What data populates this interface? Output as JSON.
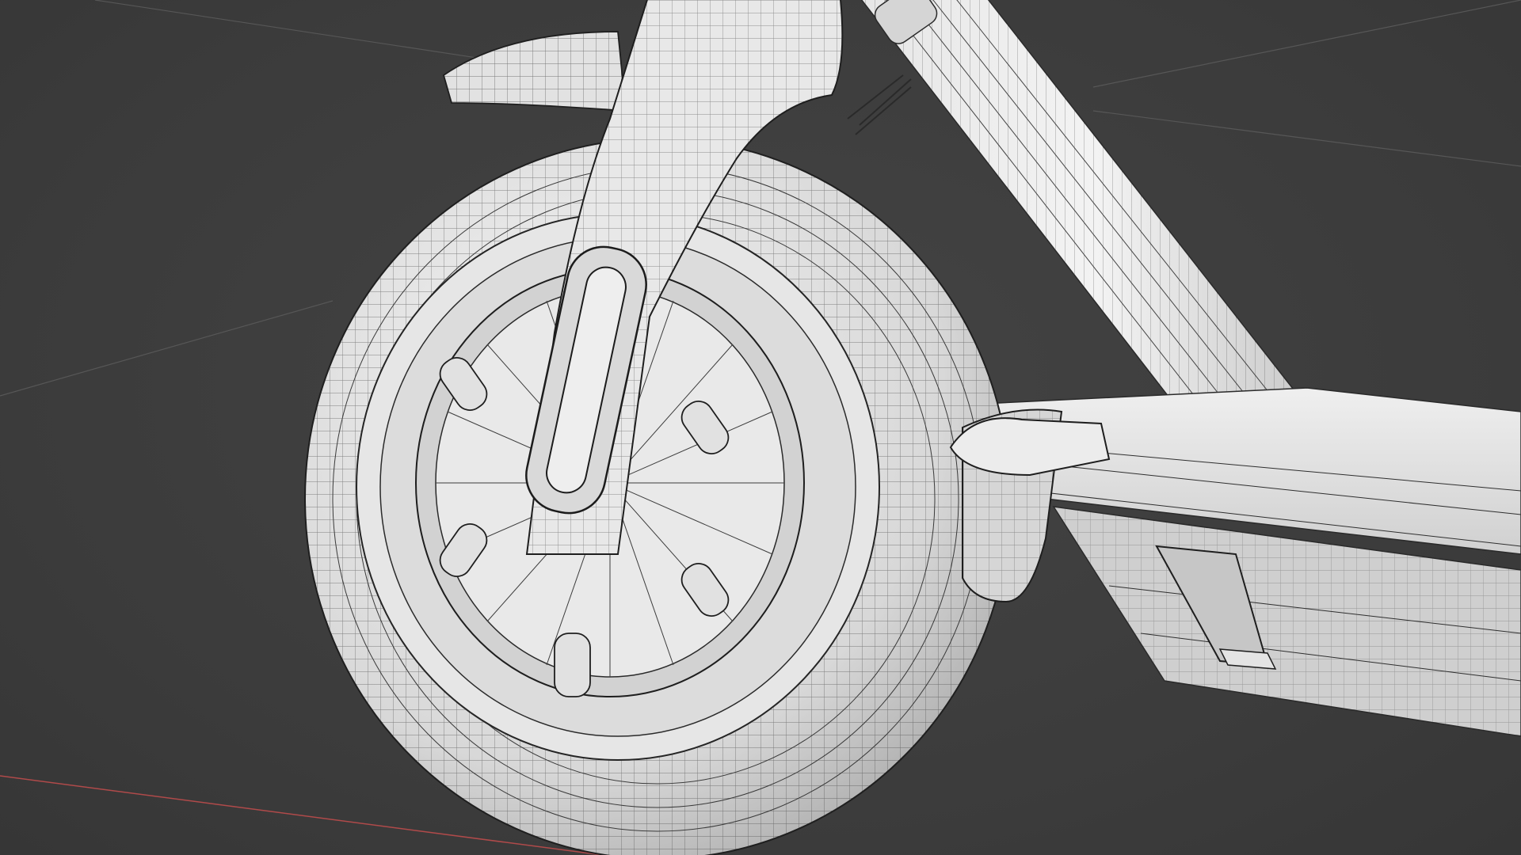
{
  "viewport": {
    "background_color": "#3d3d3d",
    "grid_line_color": "#575757",
    "x_axis_color": "#b04a4a",
    "mesh_fill_color": "#dcdcdc",
    "wire_color": "#2a2a2a",
    "shading": "solid-with-wireframe"
  },
  "scene": {
    "object": "electric-scooter-front-wheel",
    "parts": [
      "front-wheel",
      "tire",
      "wheel-hub",
      "front-fork",
      "fork-slot",
      "front-fender",
      "steering-column",
      "deck",
      "deck-side-light",
      "brake-cable",
      "kickstand"
    ]
  }
}
